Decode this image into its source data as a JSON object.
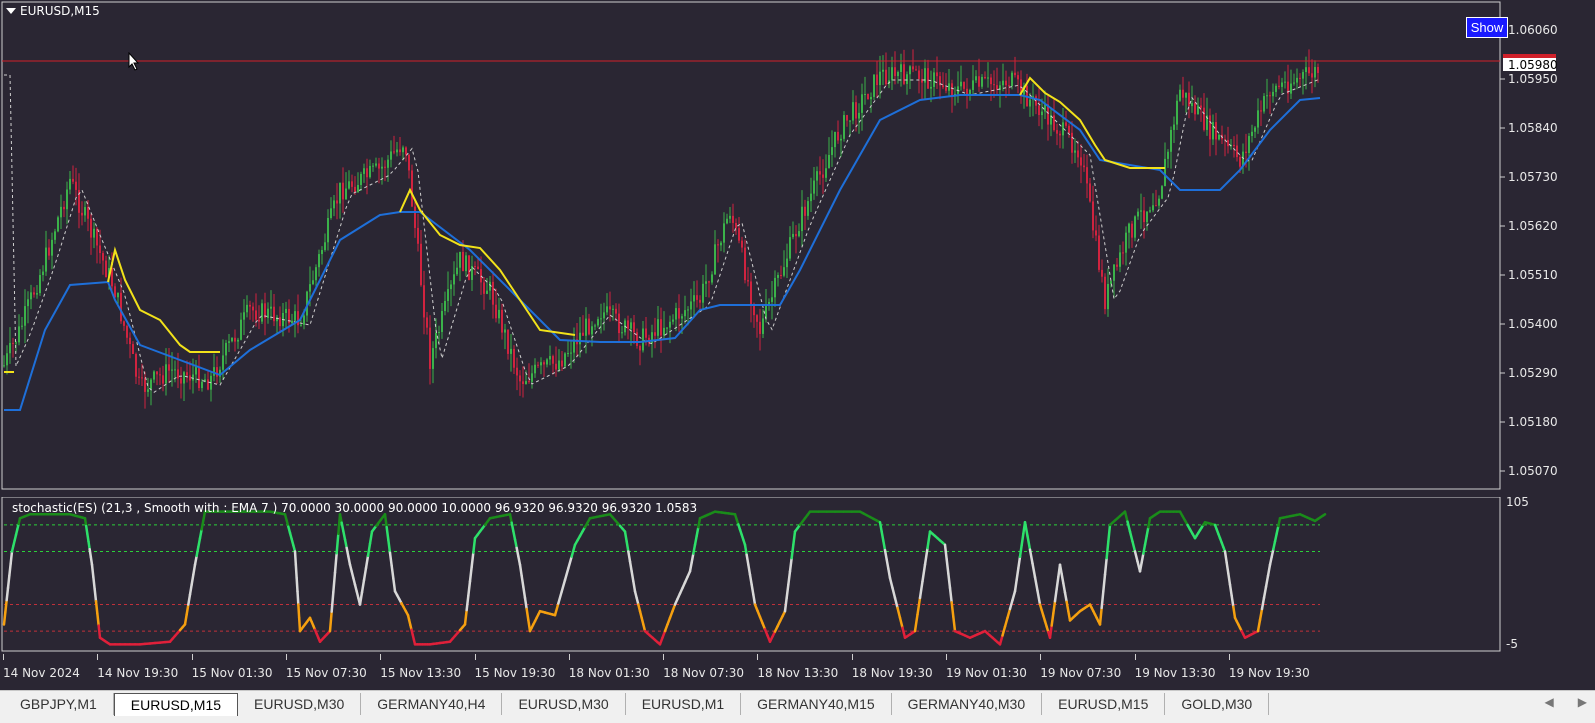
{
  "chart": {
    "title": "EURUSD,M15",
    "show_button": "Show",
    "current_price": "1.05980",
    "price_ticks": [
      "1.06060",
      "1.05950",
      "1.05840",
      "1.05730",
      "1.05620",
      "1.05510",
      "1.05400",
      "1.05290",
      "1.05180",
      "1.05070"
    ],
    "colors": {
      "background": "#2a2633",
      "bull": "#3bb24a",
      "bear": "#d0233f",
      "blue_line": "#1e6fd9",
      "yellow_line": "#f2e21a",
      "price_line": "#d0202a"
    }
  },
  "oscillator": {
    "title": "stochastic(ES) (21,3 , Smooth with : EMA  7 ) 70.0000 30.0000 90.0000 10.0000 96.9320 96.9320 96.9320 1.0583",
    "tick_top": "105",
    "tick_bottom": "-5",
    "levels": [
      90,
      70,
      30,
      10
    ]
  },
  "time_axis": {
    "labels": [
      "14 Nov 2024",
      "14 Nov 19:30",
      "15 Nov 01:30",
      "15 Nov 07:30",
      "15 Nov 13:30",
      "15 Nov 19:30",
      "18 Nov 01:30",
      "18 Nov 07:30",
      "18 Nov 13:30",
      "18 Nov 19:30",
      "19 Nov 01:30",
      "19 Nov 07:30",
      "19 Nov 13:30",
      "19 Nov 19:30"
    ]
  },
  "tabs": [
    {
      "label": "GBPJPY,M1",
      "active": false
    },
    {
      "label": "EURUSD,M15",
      "active": true
    },
    {
      "label": "EURUSD,M30",
      "active": false
    },
    {
      "label": "GERMANY40,H4",
      "active": false
    },
    {
      "label": "EURUSD,M30",
      "active": false
    },
    {
      "label": "EURUSD,M1",
      "active": false
    },
    {
      "label": "GERMANY40,M15",
      "active": false
    },
    {
      "label": "GERMANY40,M30",
      "active": false
    },
    {
      "label": "EURUSD,M15",
      "active": false
    },
    {
      "label": "GOLD,M30",
      "active": false
    }
  ],
  "tab_scroll": {
    "left": "◀",
    "right": "▶"
  }
}
